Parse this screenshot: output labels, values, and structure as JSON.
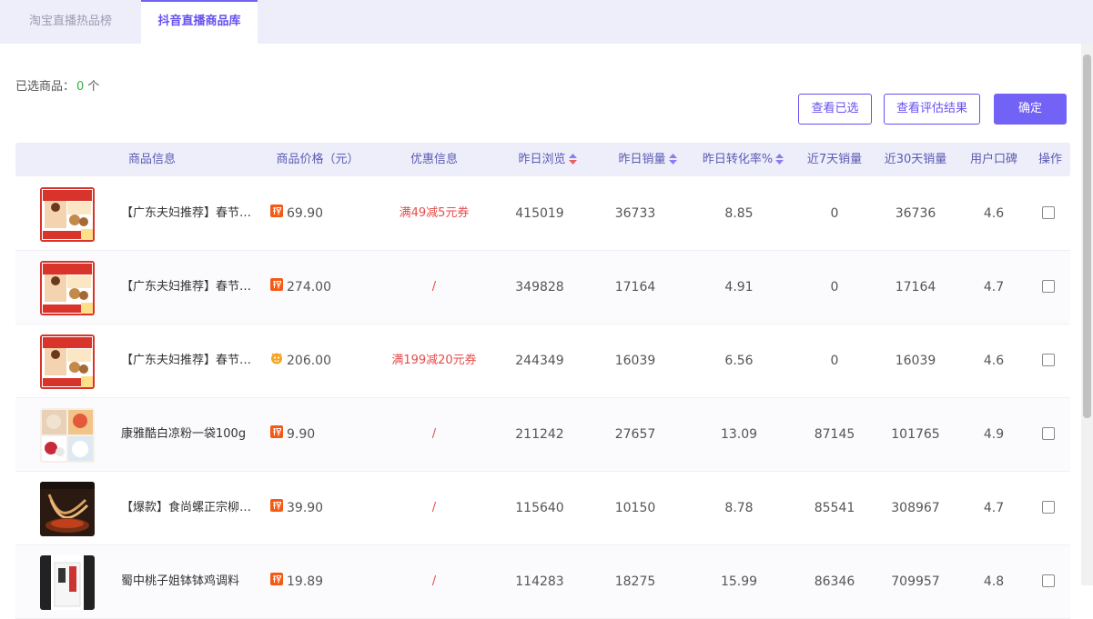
{
  "tabs": [
    {
      "label": "淘宝直播热品榜",
      "active": false
    },
    {
      "label": "抖音直播商品库",
      "active": true
    }
  ],
  "selection": {
    "label": "已选商品：",
    "count": "0",
    "unit": "个"
  },
  "buttons": {
    "view_selected": "查看已选",
    "view_evaluation": "查看评估结果",
    "confirm": "确定"
  },
  "colors": {
    "accent": "#7262f5",
    "coupon": "#e94a4a",
    "count": "#2fb344",
    "header_bg": "#eeeefa"
  },
  "table": {
    "headers": {
      "product_info": "商品信息",
      "price": "商品价格（元）",
      "promo": "优惠信息",
      "views": "昨日浏览",
      "sales": "昨日销量",
      "conversion": "昨日转化率%",
      "sales_7d": "近7天销量",
      "sales_30d": "近30天销量",
      "rating": "用户口碑",
      "action": "操作"
    },
    "rows": [
      {
        "name": "【广东夫妇推荐】春节坚果大礼包",
        "platform": "taobao-icon",
        "price": "69.90",
        "promo": "满49减5元券",
        "views": "415019",
        "sales": "36733",
        "conversion": "8.85",
        "sales_7d": "0",
        "sales_30d": "36736",
        "rating": "4.6",
        "thumb": "gift-box-a"
      },
      {
        "name": "【广东夫妇推荐】春节坚果大礼包",
        "platform": "taobao-icon",
        "price": "274.00",
        "promo": "/",
        "views": "349828",
        "sales": "17164",
        "conversion": "4.91",
        "sales_7d": "0",
        "sales_30d": "17164",
        "rating": "4.7",
        "thumb": "gift-box-b"
      },
      {
        "name": "【广东夫妇推荐】春节坚果大礼包",
        "platform": "tmall-icon",
        "price": "206.00",
        "promo": "满199减20元券",
        "views": "244349",
        "sales": "16039",
        "conversion": "6.56",
        "sales_7d": "0",
        "sales_30d": "16039",
        "rating": "4.6",
        "thumb": "gift-box-c"
      },
      {
        "name": "康雅酷白凉粉一袋100g",
        "platform": "taobao-icon",
        "price": "9.90",
        "promo": "/",
        "views": "211242",
        "sales": "27657",
        "conversion": "13.09",
        "sales_7d": "87145",
        "sales_30d": "101765",
        "rating": "4.9",
        "thumb": "jelly"
      },
      {
        "name": "【爆款】食尚螺正宗柳州螺蛳粉",
        "platform": "taobao-icon",
        "price": "39.90",
        "promo": "/",
        "views": "115640",
        "sales": "10150",
        "conversion": "8.78",
        "sales_7d": "85541",
        "sales_30d": "308967",
        "rating": "4.7",
        "thumb": "noodles"
      },
      {
        "name": "蜀中桃子姐钵钵鸡调料",
        "platform": "taobao-icon",
        "price": "19.89",
        "promo": "/",
        "views": "114283",
        "sales": "18275",
        "conversion": "15.99",
        "sales_7d": "86346",
        "sales_30d": "709957",
        "rating": "4.8",
        "thumb": "seasoning"
      }
    ]
  }
}
